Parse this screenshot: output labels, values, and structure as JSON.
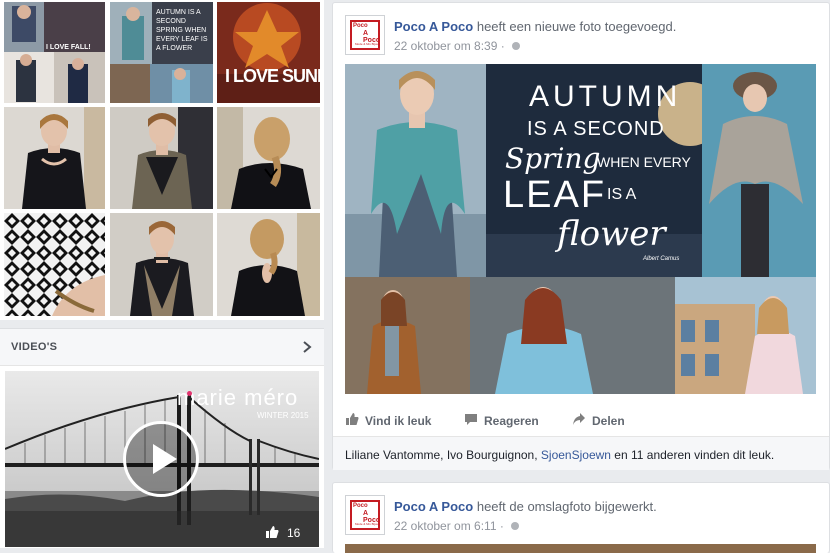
{
  "photos": {
    "thumb_captions": [
      "I LOVE FALL!",
      "AUTUMN IS A SECOND SPRING WHEN EVERY LEAF IS A FLOWER",
      "I LOVE SUNNY"
    ]
  },
  "videos": {
    "title": "VIDEO'S",
    "brand": "marie méro",
    "season": "WINTER 2015",
    "like_count": "16"
  },
  "post1": {
    "page_name": "Poco A Poco",
    "action_text": "heeft een nieuwe foto toegevoegd.",
    "timestamp": "22 oktober om 8:39",
    "avatar": {
      "line1": "Poco",
      "line2": "A Poco",
      "line3": "Mode & Mix Bijoux"
    },
    "image_text": [
      "AUTUMN",
      "IS A SECOND",
      "Spring",
      "WHEN EVERY",
      "LEAF",
      "IS A",
      "flower",
      "Albert Camus"
    ],
    "actions": {
      "like": "Vind ik leuk",
      "comment": "Reageren",
      "share": "Delen"
    },
    "likes": {
      "names": "Liliane Vantomme, Ivo Bourguignon, ",
      "link_name": "SjoenSjoewn",
      "rest": " en 11 anderen vinden dit leuk."
    }
  },
  "post2": {
    "page_name": "Poco A Poco",
    "action_text": "heeft de omslagfoto bijgewerkt.",
    "timestamp": "22 oktober om 6:11"
  },
  "colors": {
    "fb_blue": "#365899",
    "brand_red": "#c41b22",
    "meta_grey": "#90949c"
  }
}
